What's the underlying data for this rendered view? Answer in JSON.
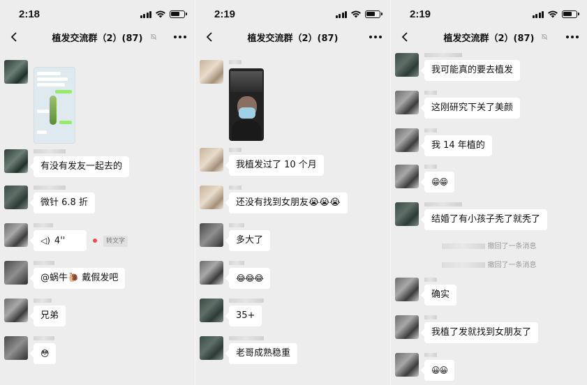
{
  "chat_title": "植发交流群（2）(87)",
  "screens": [
    {
      "time": "2:18",
      "messages": [
        {
          "kind": "text",
          "text": "有没有发友一起去的"
        },
        {
          "kind": "text",
          "text": "微针 6.8 折"
        },
        {
          "kind": "voice",
          "duration": "4''",
          "convert_label": "转文字"
        },
        {
          "kind": "text",
          "text": "@蜗牛🐌 戴假发吧"
        },
        {
          "kind": "text",
          "text": "兄弟"
        },
        {
          "kind": "emoji",
          "text": "😳"
        }
      ]
    },
    {
      "time": "2:19",
      "messages": [
        {
          "kind": "text",
          "text": "我植发过了 10 个月"
        },
        {
          "kind": "text",
          "text": "还没有找到女朋友😭😭😭"
        },
        {
          "kind": "text",
          "text": "多大了"
        },
        {
          "kind": "emoji",
          "text": "😂😂😂"
        },
        {
          "kind": "text",
          "text": "35+"
        },
        {
          "kind": "text",
          "text": "老哥成熟稳重"
        }
      ]
    },
    {
      "time": "2:19",
      "messages": [
        {
          "kind": "text",
          "text": "我可能真的要去植发"
        },
        {
          "kind": "text",
          "text": "这刚研究下关了美颜"
        },
        {
          "kind": "text",
          "text": "我 14 年植的"
        },
        {
          "kind": "emoji",
          "text": "😁😁"
        },
        {
          "kind": "text",
          "text": "结婚了有小孩子秃了就秃了"
        },
        {
          "kind": "system",
          "text": "撤回了一条消息"
        },
        {
          "kind": "system",
          "text": "撤回了一条消息"
        },
        {
          "kind": "text",
          "text": "确实"
        },
        {
          "kind": "text",
          "text": "我植了发就找到女朋友了"
        },
        {
          "kind": "emoji",
          "text": "😀😀"
        }
      ]
    }
  ]
}
